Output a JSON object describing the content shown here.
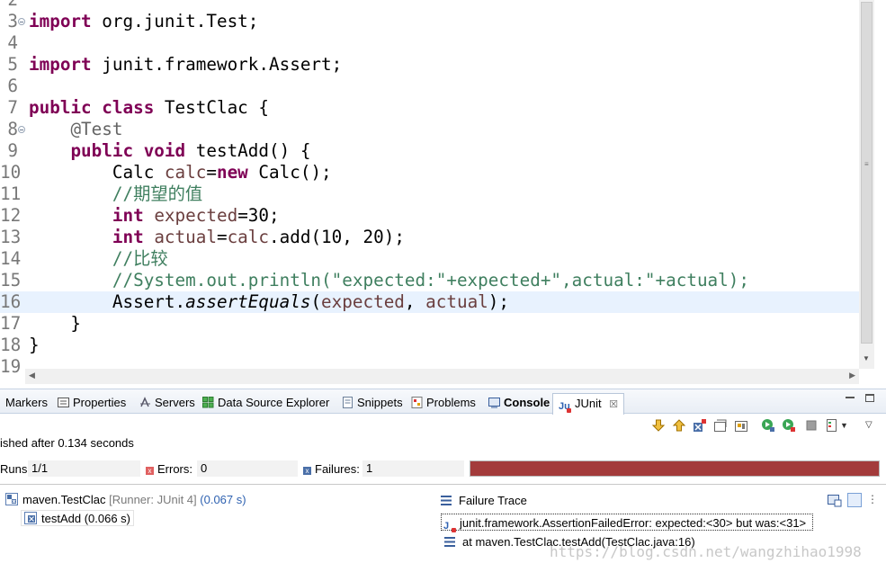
{
  "editor": {
    "lines": [
      {
        "num": "2",
        "fold": false,
        "current": false,
        "parts": []
      },
      {
        "num": "3",
        "fold": true,
        "current": false,
        "parts": [
          [
            "kw",
            "import"
          ],
          [
            "",
            " org.junit.Test;"
          ]
        ]
      },
      {
        "num": "4",
        "fold": false,
        "current": false,
        "parts": []
      },
      {
        "num": "5",
        "fold": false,
        "current": false,
        "parts": [
          [
            "kw",
            "import"
          ],
          [
            "",
            " junit.framework.Assert;"
          ]
        ]
      },
      {
        "num": "6",
        "fold": false,
        "current": false,
        "parts": []
      },
      {
        "num": "7",
        "fold": false,
        "current": false,
        "parts": [
          [
            "kw",
            "public"
          ],
          [
            "",
            " "
          ],
          [
            "kw",
            "class"
          ],
          [
            "",
            " TestClac {"
          ]
        ]
      },
      {
        "num": "8",
        "fold": true,
        "current": false,
        "parts": [
          [
            "",
            "    "
          ],
          [
            "ann",
            "@Test"
          ]
        ]
      },
      {
        "num": "9",
        "fold": false,
        "current": false,
        "parts": [
          [
            "",
            "    "
          ],
          [
            "kw",
            "public"
          ],
          [
            "",
            " "
          ],
          [
            "kw",
            "void"
          ],
          [
            "",
            " testAdd() {"
          ]
        ]
      },
      {
        "num": "10",
        "fold": false,
        "current": false,
        "parts": [
          [
            "",
            "        Calc "
          ],
          [
            "var",
            "calc"
          ],
          [
            "",
            "="
          ],
          [
            "kw",
            "new"
          ],
          [
            "",
            " Calc();"
          ]
        ]
      },
      {
        "num": "11",
        "fold": false,
        "current": false,
        "parts": [
          [
            "",
            "        "
          ],
          [
            "cm",
            "//期望的值"
          ]
        ]
      },
      {
        "num": "12",
        "fold": false,
        "current": false,
        "parts": [
          [
            "",
            "        "
          ],
          [
            "kw",
            "int"
          ],
          [
            "",
            " "
          ],
          [
            "var",
            "expected"
          ],
          [
            "",
            "=30;"
          ]
        ]
      },
      {
        "num": "13",
        "fold": false,
        "current": false,
        "parts": [
          [
            "",
            "        "
          ],
          [
            "kw",
            "int"
          ],
          [
            "",
            " "
          ],
          [
            "var",
            "actual"
          ],
          [
            "",
            "="
          ],
          [
            "var",
            "calc"
          ],
          [
            "",
            ".add(10, 20);"
          ]
        ]
      },
      {
        "num": "14",
        "fold": false,
        "current": false,
        "parts": [
          [
            "",
            "        "
          ],
          [
            "cm",
            "//比较"
          ]
        ]
      },
      {
        "num": "15",
        "fold": false,
        "current": false,
        "parts": [
          [
            "",
            "        "
          ],
          [
            "cm",
            "//System.out.println(\"expected:\"+expected+\",actual:\"+actual);"
          ]
        ]
      },
      {
        "num": "16",
        "fold": false,
        "current": true,
        "parts": [
          [
            "",
            "        Assert."
          ],
          [
            "it",
            "assertEquals"
          ],
          [
            "",
            "("
          ],
          [
            "var",
            "expected"
          ],
          [
            "",
            ", "
          ],
          [
            "var",
            "actual"
          ],
          [
            "",
            ");"
          ]
        ]
      },
      {
        "num": "17",
        "fold": false,
        "current": false,
        "parts": [
          [
            "",
            "    }"
          ]
        ]
      },
      {
        "num": "18",
        "fold": false,
        "current": false,
        "parts": [
          [
            "",
            "}"
          ]
        ]
      },
      {
        "num": "19",
        "fold": false,
        "current": false,
        "parts": []
      }
    ]
  },
  "panel": {
    "tabs": {
      "markers": "Markers",
      "properties": "Properties",
      "servers": "Servers",
      "data_source_explorer": "Data Source Explorer",
      "snippets": "Snippets",
      "problems": "Problems",
      "console": "Console",
      "junit": "JUnit",
      "junit_close": "☒"
    },
    "status": "ished after 0.134 seconds",
    "counters": {
      "runs_label": "Runs:",
      "runs_value": "1/1",
      "errors_label": "Errors:",
      "errors_value": "0",
      "failures_label": "Failures:",
      "failures_value": "1",
      "progress": 1.0
    },
    "tree": {
      "root_name": "maven.TestClac",
      "root_runner": "[Runner: JUnit 4]",
      "root_time": "(0.067 s)",
      "child": "testAdd (0.066 s)"
    },
    "trace": {
      "title": "Failure Trace",
      "line1": "junit.framework.AssertionFailedError: expected:<30> but was:<31>",
      "line2": "at maven.TestClac.testAdd(TestClac.java:16)"
    }
  },
  "watermark": "https://blog.csdn.net/wangzhihao1998",
  "colors": {
    "keyword": "#7f0055",
    "comment": "#3f7f5f",
    "variable": "#6a3e3e",
    "annotation": "#646464",
    "failure_bar": "#a33b3b",
    "current_line": "#e8f2fe"
  },
  "icons": {
    "toolbar": [
      "next-failure-icon",
      "previous-failure-icon",
      "show-failures-only-icon",
      "scroll-lock-icon",
      "history-icon",
      "rerun-icon",
      "rerun-failed-first-icon",
      "stop-icon",
      "test-run-history-icon",
      "view-menu-icon"
    ]
  }
}
